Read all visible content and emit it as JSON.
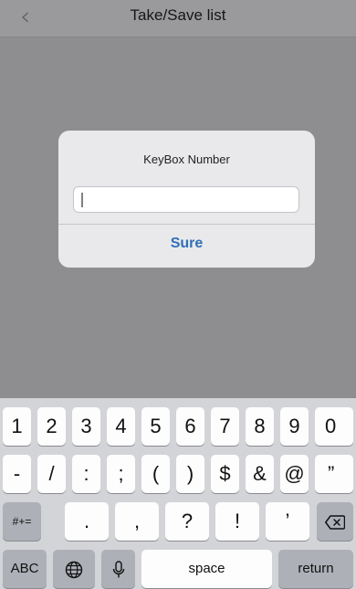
{
  "nav": {
    "back_icon": "chevron-left-icon",
    "title": "Take/Save list"
  },
  "alert": {
    "title": "KeyBox Number",
    "input_value": "",
    "button_label": "Sure"
  },
  "keyboard": {
    "row1": [
      "1",
      "2",
      "3",
      "4",
      "5",
      "6",
      "7",
      "8",
      "9",
      "0"
    ],
    "row2": [
      "-",
      "/",
      ":",
      ";",
      "(",
      ")",
      "$",
      "&",
      "@",
      "”"
    ],
    "row3": {
      "symbols_toggle": "#+=",
      "keys": [
        ".",
        ",",
        "?",
        "!",
        "’"
      ],
      "delete_icon": "backspace-icon"
    },
    "row4": {
      "abc": "ABC",
      "globe_icon": "globe-icon",
      "mic_icon": "microphone-icon",
      "space": "space",
      "return": "return"
    }
  }
}
